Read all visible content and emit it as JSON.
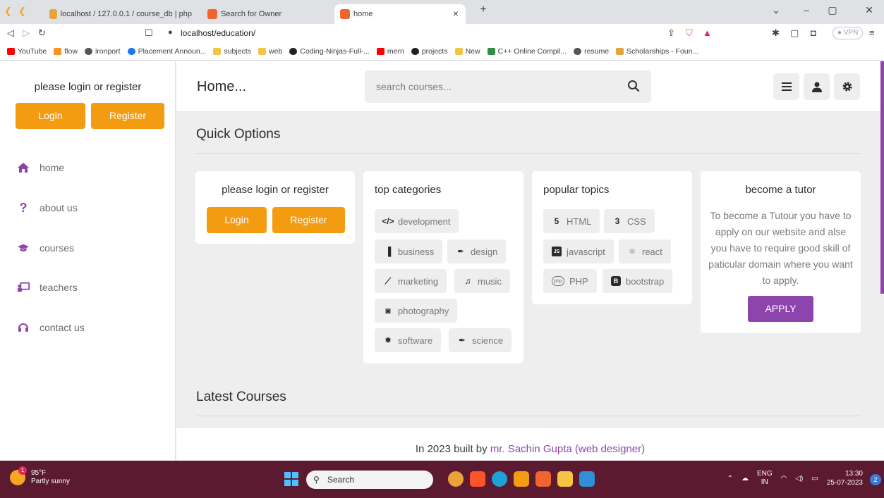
{
  "browser": {
    "tabs": [
      {
        "label": "localhost / 127.0.0.1 / course_db | php"
      },
      {
        "label": "Search for Owner"
      },
      {
        "label": "home"
      }
    ],
    "new_tab": "+",
    "url": "localhost/education/",
    "vpn": "VPN",
    "bookmarks": [
      "YouTube",
      "flow",
      "ironport",
      "Placement Announ...",
      "subjects",
      "web",
      "Coding-Ninjas-Full-...",
      "mern",
      "projects",
      "New",
      "C++ Online Compil...",
      "resume",
      "Scholarships - Foun..."
    ]
  },
  "sidebar": {
    "title": "please login or register",
    "login": "Login",
    "register": "Register",
    "nav": [
      {
        "label": "home",
        "icon": "home-icon"
      },
      {
        "label": "about us",
        "icon": "question-icon"
      },
      {
        "label": "courses",
        "icon": "graduation-cap-icon"
      },
      {
        "label": "teachers",
        "icon": "chalkboard-teacher-icon"
      },
      {
        "label": "contact us",
        "icon": "headset-icon"
      }
    ]
  },
  "header": {
    "title": "Home...",
    "search_placeholder": "search courses..."
  },
  "main": {
    "quick_options": "Quick Options",
    "login_card": {
      "title": "please login or register",
      "login": "Login",
      "register": "Register"
    },
    "categories": {
      "title": "top categories",
      "items": [
        "development",
        "business",
        "design",
        "marketing",
        "music",
        "photography",
        "software",
        "science"
      ]
    },
    "topics": {
      "title": "popular topics",
      "items": [
        "HTML",
        "CSS",
        "javascript",
        "react",
        "PHP",
        "bootstrap"
      ]
    },
    "tutor": {
      "title": "become a tutor",
      "text": "To become a Tutour you have to apply on our website and alse you have to require good skill of paticular domain where you want to apply.",
      "apply": "APPLY"
    },
    "latest_courses": "Latest Courses"
  },
  "footer": {
    "prefix": "In 2023 built by ",
    "link": "mr. Sachin Gupta (web designer)"
  },
  "taskbar": {
    "badge_count": "1",
    "temperature": "95°F",
    "weather": "Partly sunny",
    "search": "Search",
    "lang": "ENG",
    "region": "IN",
    "time": "13:30",
    "date": "25-07-2023",
    "notifications": "2"
  },
  "colors": {
    "accent_orange": "#f39c12",
    "accent_purple": "#8e44ad"
  }
}
